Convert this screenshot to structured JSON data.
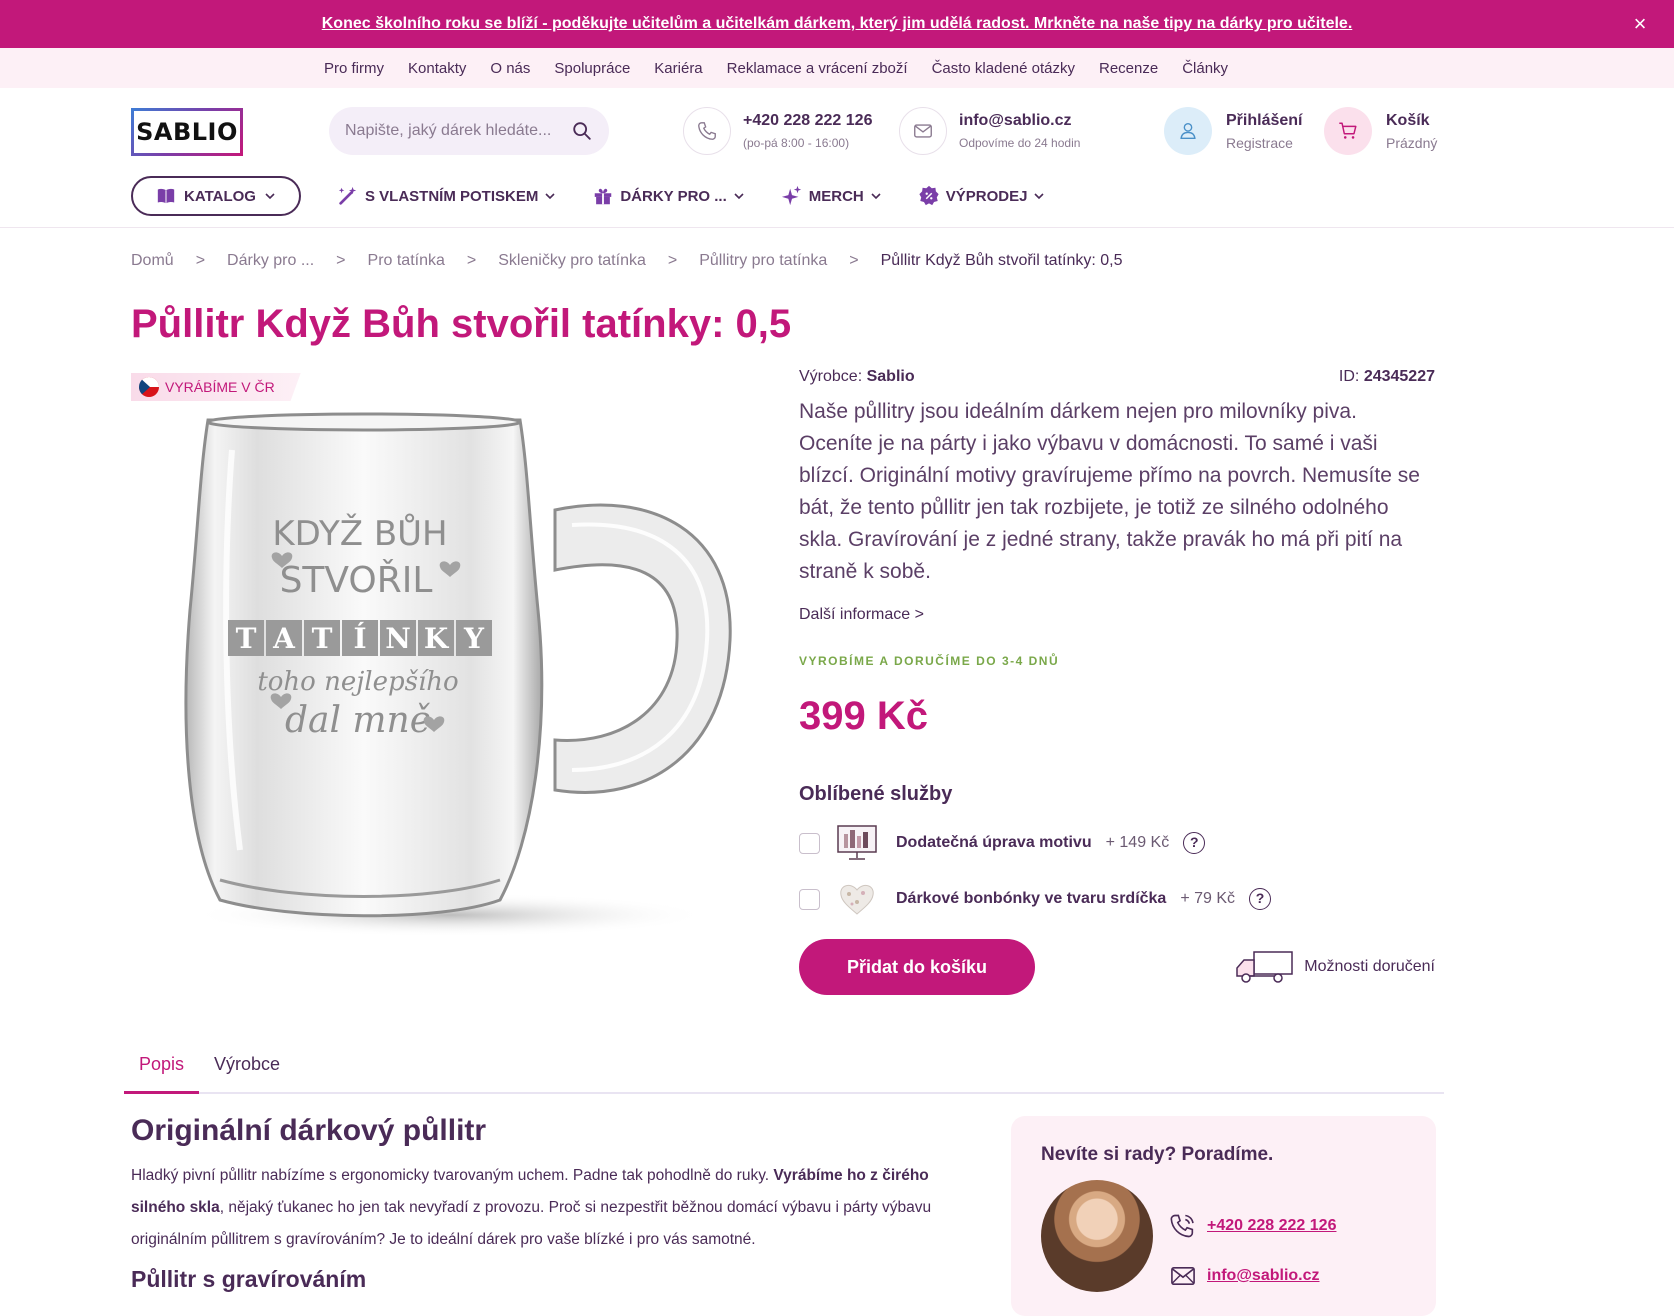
{
  "promo": {
    "text": "Konec školního roku se blíží - poděkujte učitelům a učitelkám dárkem, který jim udělá radost. Mrkněte na naše tipy na dárky pro učitele.",
    "close": "×"
  },
  "top_links": [
    "Pro firmy",
    "Kontakty",
    "O nás",
    "Spolupráce",
    "Kariéra",
    "Reklamace a vrácení zboží",
    "Často kladené otázky",
    "Recenze",
    "Články"
  ],
  "header": {
    "logo": "SABLIO",
    "search_placeholder": "Napište, jaký dárek hledáte...",
    "phone": "+420 228 222 126",
    "phone_hours": "(po-pá 8:00 - 16:00)",
    "email": "info@sablio.cz",
    "email_note": "Odpovíme do 24 hodin",
    "login": "Přihlášení",
    "register": "Registrace",
    "cart": "Košík",
    "cart_status": "Prázdný"
  },
  "nav": {
    "katalog": "KATALOG",
    "items": [
      "S VLASTNÍM POTISKEM",
      "DÁRKY PRO ...",
      "MERCH",
      "VÝPRODEJ"
    ]
  },
  "breadcrumb": {
    "items": [
      "Domů",
      "Dárky pro ...",
      "Pro tatínka",
      "Skleničky pro tatínka",
      "Půllitry pro tatínka"
    ],
    "current": "Půllitr Když Bůh stvořil tatínky: 0,5",
    "separator": ">"
  },
  "product": {
    "title": "Půllitr Když Bůh stvořil tatínky: 0,5",
    "badge": "VYRÁBÍME V ČR",
    "engraving": {
      "line1": "KDYŽ BŮH",
      "line2": "STVOŘIL",
      "letters": [
        "T",
        "A",
        "T",
        "Í",
        "N",
        "K",
        "Y"
      ],
      "line3": "toho nejlepšího",
      "line4": "dal mně"
    },
    "manufacturer_label": "Výrobce:",
    "manufacturer": "Sablio",
    "id_label": "ID:",
    "id": "24345227",
    "description": "Naše půllitry jsou ideálním dárkem nejen pro milovníky piva. Oceníte je na párty i jako výbavu v domácnosti. To samé i vaši blízcí. Originální motivy gravírujeme přímo na povrch. Nemusíte se bát, že tento půllitr jen tak rozbijete, je totiž ze silného odolného skla. Gravírování je z jedné strany, takže pravák ho má při pití na straně k sobě.",
    "more_info": "Další informace >",
    "shipping": "VYROBÍME A DORUČÍME DO 3-4 DNŮ",
    "price": "399 Kč",
    "services_title": "Oblíbené služby",
    "services": [
      {
        "name": "Dodatečná úprava motivu",
        "price": "+ 149 Kč",
        "checked": false
      },
      {
        "name": "Dárkové bonbónky ve tvaru srdíčka",
        "price": "+ 79 Kč",
        "checked": false
      }
    ],
    "add_to_cart": "Přidat do košíku",
    "delivery_options": "Možnosti doručení"
  },
  "tabs": [
    {
      "label": "Popis",
      "active": true
    },
    {
      "label": "Výrobce",
      "active": false
    }
  ],
  "content": {
    "heading": "Originální dárkový půllitr",
    "para_part1": "Hladký pivní půllitr nabízíme s ergonomicky tvarovaným uchem. Padne tak pohodlně do ruky. ",
    "para_bold": "Vyrábíme ho z čirého silného skla",
    "para_part2": ", nějaký ťukanec ho jen tak nevyřadí z provozu. Proč si nezpestřit běžnou domácí výbavu i párty výbavu originálním půllitrem s gravírováním? Je to ideální dárek pro vaše blízké i pro vás samotné.",
    "subheading": "Půllitr s gravírováním"
  },
  "help": {
    "title": "Nevíte si rady? Poradíme.",
    "phone": "+420 228 222 126",
    "email": "info@sablio.cz"
  },
  "colors": {
    "brand": "#c2187a",
    "text": "#4a2b57",
    "light_pink": "#fdf0f6",
    "green": "#7aa84a"
  }
}
